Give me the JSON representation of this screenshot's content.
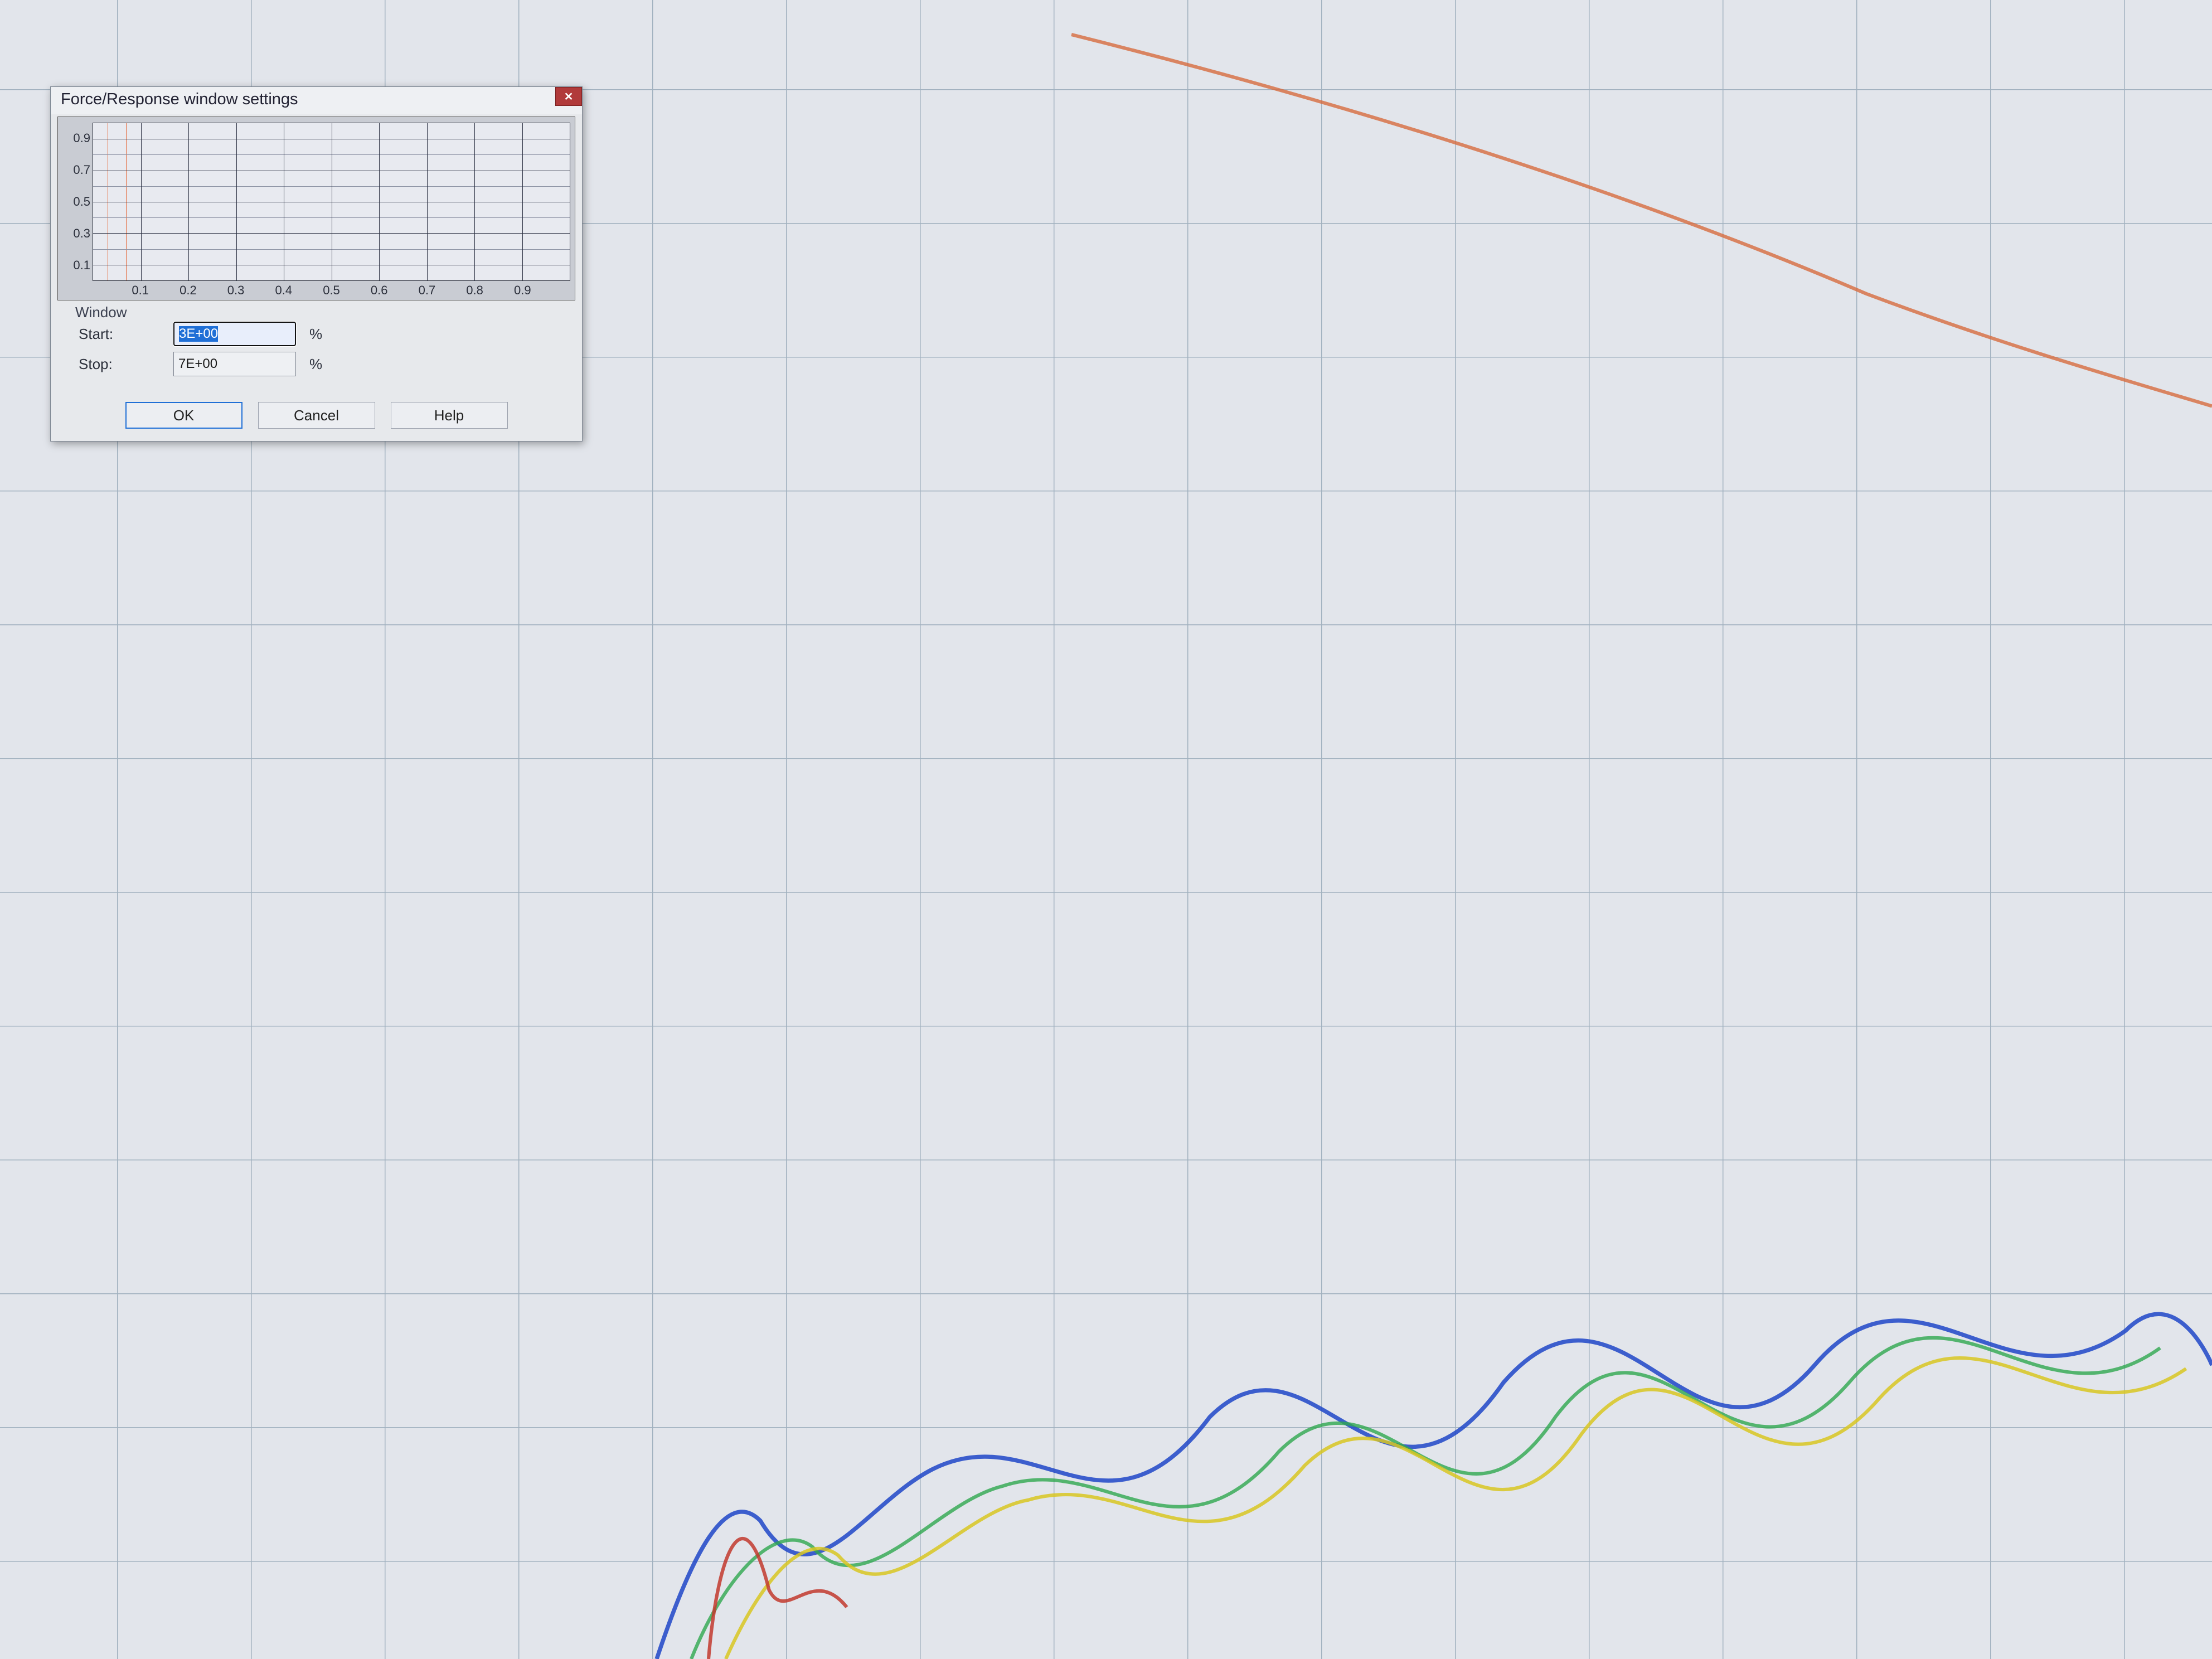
{
  "dialog": {
    "title": "Force/Response window settings",
    "close_glyph": "✕"
  },
  "chart_data": {
    "type": "area",
    "title": "",
    "xlabel": "",
    "ylabel": "",
    "xlim": [
      0,
      1
    ],
    "ylim": [
      0,
      1
    ],
    "xticks": [
      0.1,
      0.2,
      0.3,
      0.4,
      0.5,
      0.6,
      0.7,
      0.8,
      0.9
    ],
    "yticks": [
      0.1,
      0.3,
      0.5,
      0.7,
      0.9
    ],
    "window_cursor": {
      "start_frac": 0.03,
      "stop_frac": 0.07
    }
  },
  "window_group": {
    "label": "Window",
    "start_label": "Start:",
    "start_value": "3E+00",
    "start_unit": "%",
    "stop_label": "Stop:",
    "stop_value": "7E+00",
    "stop_unit": "%"
  },
  "buttons": {
    "ok": "OK",
    "cancel": "Cancel",
    "help": "Help"
  }
}
